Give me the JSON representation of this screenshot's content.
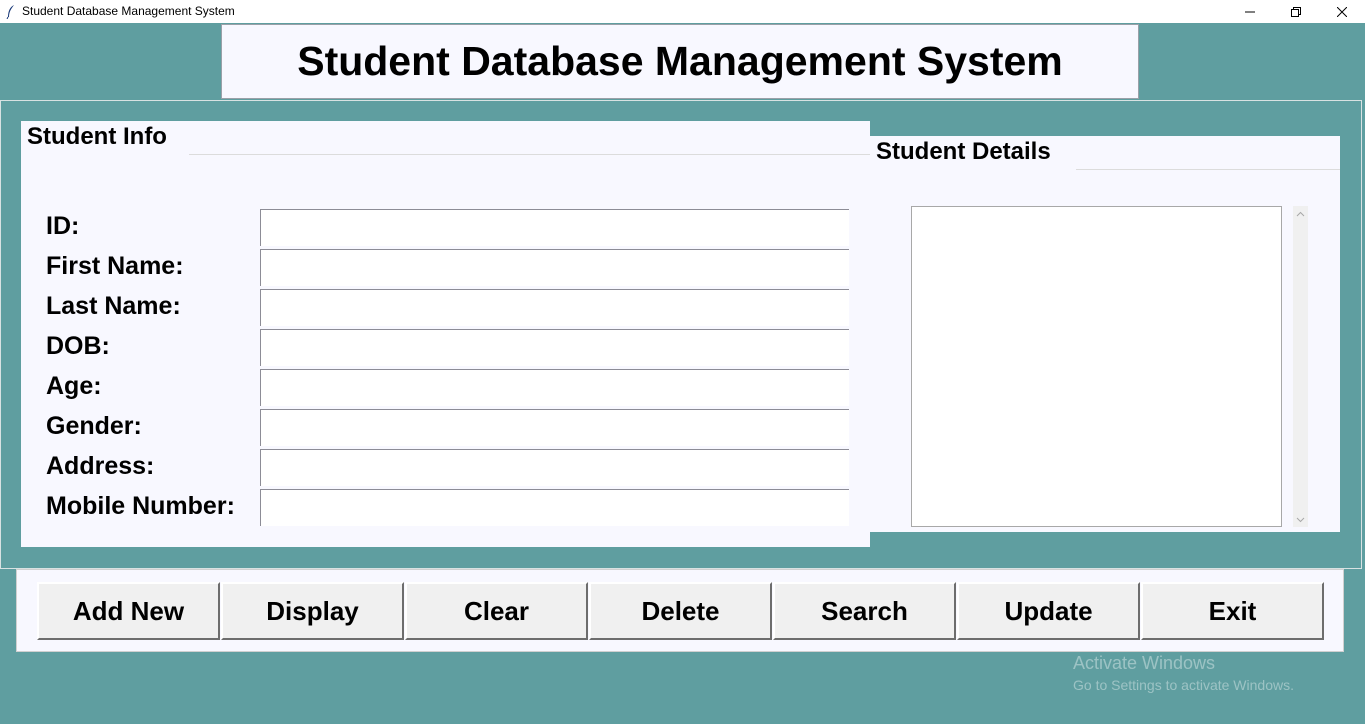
{
  "window": {
    "title": "Student Database Management System",
    "icon": "feather-icon",
    "controls": [
      "minimize-icon",
      "maximize-icon",
      "close-icon"
    ]
  },
  "colors": {
    "background": "#5f9ea0",
    "panel": "#f8f8ff",
    "button_face": "#f0f0f0"
  },
  "heading": "Student Database Management System",
  "student_info": {
    "title": "Student Info",
    "fields": [
      {
        "label": "ID:",
        "value": ""
      },
      {
        "label": "First Name:",
        "value": ""
      },
      {
        "label": "Last Name:",
        "value": ""
      },
      {
        "label": "DOB:",
        "value": ""
      },
      {
        "label": "Age:",
        "value": ""
      },
      {
        "label": "Gender:",
        "value": ""
      },
      {
        "label": "Address:",
        "value": ""
      },
      {
        "label": "Mobile Number:",
        "value": ""
      }
    ]
  },
  "student_details": {
    "title": "Student Details",
    "items": []
  },
  "buttons": [
    "Add New",
    "Display",
    "Clear",
    "Delete",
    "Search",
    "Update",
    "Exit"
  ],
  "watermark": {
    "title": "Activate Windows",
    "subtitle": "Go to Settings to activate Windows."
  }
}
